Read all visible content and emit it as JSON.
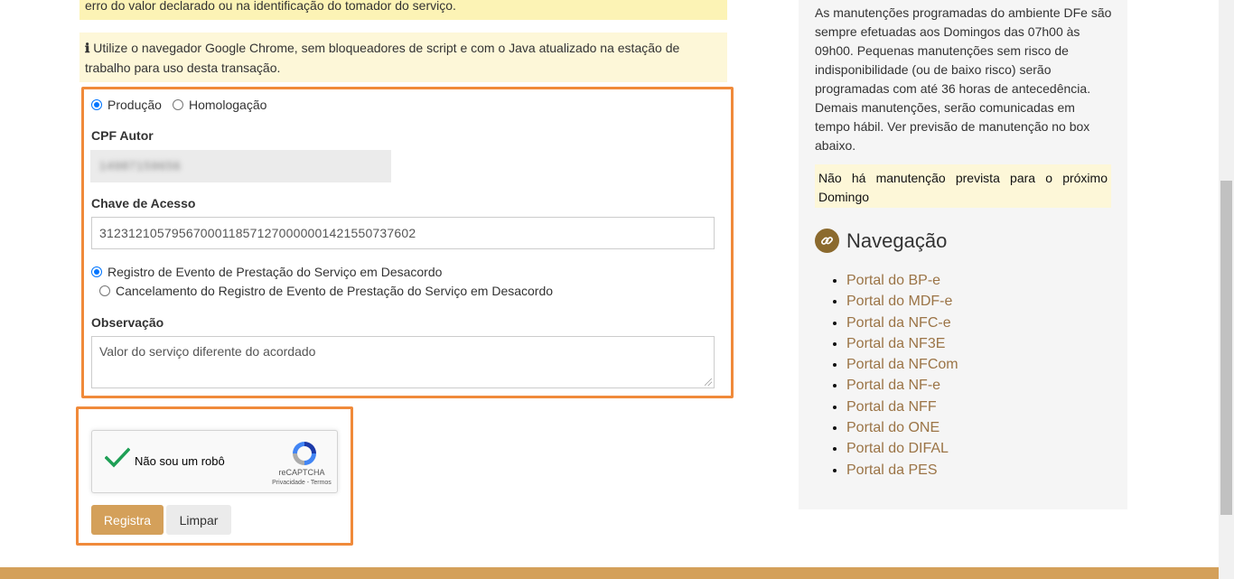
{
  "warning_text": "erro do valor declarado ou na identificação do tomador do serviço.",
  "info": {
    "icon": "info-icon",
    "text": "Utilize o navegador Google Chrome, sem bloqueadores de script e com o Java atualizado na estação de trabalho para uso desta transação."
  },
  "form": {
    "environment": {
      "options": [
        "Produção",
        "Homologação"
      ],
      "selected": "Produção"
    },
    "cpf": {
      "label": "CPF Autor",
      "value": "14987159656"
    },
    "chave": {
      "label": "Chave de Acesso",
      "value": "31231210579567000118571270000001421550737602"
    },
    "evento": {
      "options": [
        "Registro de Evento de Prestação do Serviço em Desacordo",
        "Cancelamento do Registro de Evento de Prestação do Serviço em Desacordo"
      ],
      "selected": "Registro de Evento de Prestação do Serviço em Desacordo"
    },
    "observacao": {
      "label": "Observação",
      "value": "Valor do serviço diferente do acordado"
    }
  },
  "captcha": {
    "label": "Não sou um robô",
    "brand": "reCAPTCHA",
    "privacy": "Privacidade",
    "separator": " - ",
    "terms": "Termos",
    "checked": true
  },
  "buttons": {
    "submit": "Registra",
    "clear": "Limpar"
  },
  "sidebar": {
    "maintenance_text": "As manutenções programadas do ambiente DFe são sempre efetuadas aos Domingos das 07h00 às 09h00. Pequenas manutenções sem risco de indisponibilidade (ou de baixo risco) serão programadas com até 36 horas de antecedência. Demais manutenções, serão comunicadas em tempo hábil. Ver previsão de manutenção no box abaixo.",
    "notice": "Não há manutenção prevista para o próximo Domingo",
    "nav_title": "Navegação",
    "nav_items": [
      "Portal do BP-e",
      "Portal do MDF-e",
      "Portal da NFC-e",
      "Portal da NF3E",
      "Portal da NFCom",
      "Portal da NF-e",
      "Portal da NFF",
      "Portal do ONE",
      "Portal do DIFAL",
      "Portal da PES"
    ]
  },
  "colors": {
    "accent": "#d4a05a",
    "highlight_frame": "#f08a3a",
    "link": "#9b7446",
    "warning_bg": "#fcf3b5"
  }
}
